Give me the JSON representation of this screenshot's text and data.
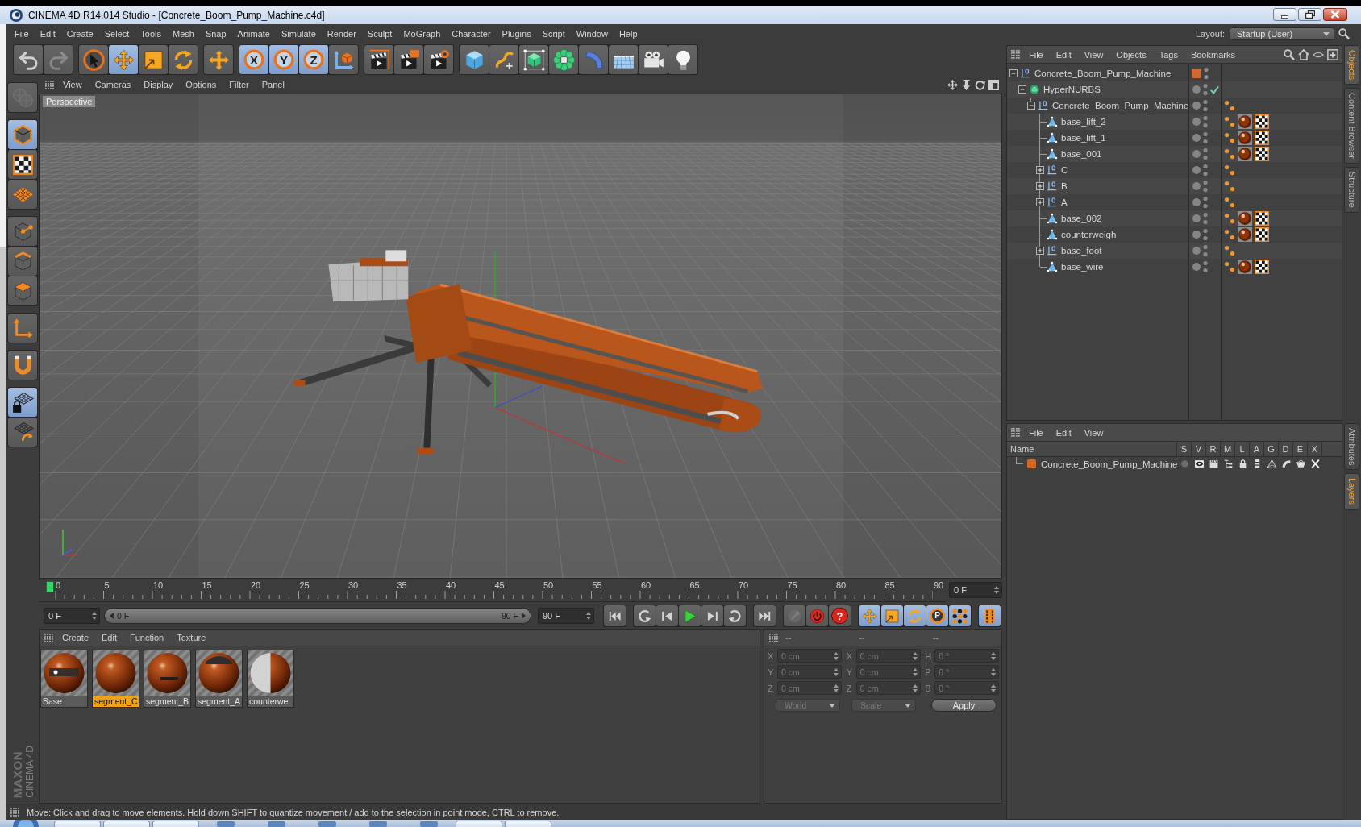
{
  "window": {
    "title": "CINEMA 4D R14.014 Studio - [Concrete_Boom_Pump_Machine.c4d]"
  },
  "menu_bar": [
    "File",
    "Edit",
    "Create",
    "Select",
    "Tools",
    "Mesh",
    "Snap",
    "Animate",
    "Simulate",
    "Render",
    "Sculpt",
    "MoGraph",
    "Character",
    "Plugins",
    "Script",
    "Window",
    "Help"
  ],
  "layout": {
    "label": "Layout:",
    "value": "Startup (User)"
  },
  "toolbar": [
    [
      {
        "kind": "undo",
        "selected": false,
        "disabled": false
      },
      {
        "kind": "redo",
        "selected": false,
        "disabled": true
      }
    ],
    [
      {
        "kind": "select",
        "selected": false,
        "disabled": false
      },
      {
        "kind": "move",
        "selected": true,
        "disabled": false
      },
      {
        "kind": "scale",
        "selected": false,
        "disabled": false
      },
      {
        "kind": "rotate",
        "selected": false,
        "disabled": false
      }
    ],
    [
      {
        "kind": "add",
        "selected": false,
        "disabled": false
      }
    ],
    [
      {
        "kind": "axis",
        "label": "X",
        "selected": true,
        "disabled": false
      },
      {
        "kind": "axis",
        "label": "Y",
        "selected": true,
        "disabled": false
      },
      {
        "kind": "axis",
        "label": "Z",
        "selected": true,
        "disabled": false
      },
      {
        "kind": "coords",
        "selected": false,
        "disabled": false
      }
    ],
    [
      {
        "kind": "render-view",
        "selected": false,
        "disabled": false
      },
      {
        "kind": "render-picture",
        "selected": false,
        "disabled": false
      },
      {
        "kind": "render-settings",
        "selected": false,
        "disabled": false
      }
    ],
    [
      {
        "kind": "cube",
        "selected": false,
        "disabled": false
      },
      {
        "kind": "spline",
        "selected": false,
        "disabled": false
      },
      {
        "kind": "subdivision",
        "selected": false,
        "disabled": false
      },
      {
        "kind": "cloner",
        "selected": false,
        "disabled": false
      },
      {
        "kind": "deformer",
        "selected": false,
        "disabled": false
      },
      {
        "kind": "floor",
        "selected": false,
        "disabled": false
      },
      {
        "kind": "camera",
        "selected": false,
        "disabled": false
      },
      {
        "kind": "light",
        "selected": false,
        "disabled": false
      }
    ]
  ],
  "tools": [
    [
      {
        "kind": "make-editable",
        "selected": false,
        "disabled": true
      }
    ],
    [
      {
        "kind": "model",
        "selected": true,
        "disabled": false
      },
      {
        "kind": "texture",
        "selected": false,
        "disabled": false
      },
      {
        "kind": "workplane",
        "selected": false,
        "disabled": false
      }
    ],
    [
      {
        "kind": "points",
        "selected": false,
        "disabled": false
      },
      {
        "kind": "edges",
        "selected": false,
        "disabled": false
      },
      {
        "kind": "polygons",
        "selected": false,
        "disabled": false
      }
    ],
    [
      {
        "kind": "axis-mode",
        "selected": false,
        "disabled": false
      }
    ],
    [
      {
        "kind": "magnet",
        "selected": false,
        "disabled": false
      }
    ],
    [
      {
        "kind": "grid-lock",
        "selected": true,
        "disabled": false
      },
      {
        "kind": "grid-rotate",
        "selected": false,
        "disabled": false
      }
    ]
  ],
  "logo": {
    "brand": "MAXON",
    "product": "CINEMA 4D"
  },
  "viewport": {
    "menu": [
      "View",
      "Cameras",
      "Display",
      "Options",
      "Filter",
      "Panel"
    ],
    "camera": "Perspective"
  },
  "timeline": {
    "ticks": [
      "0",
      "5",
      "10",
      "15",
      "20",
      "25",
      "30",
      "35",
      "40",
      "45",
      "50",
      "55",
      "60",
      "65",
      "70",
      "75",
      "80",
      "85",
      "90"
    ],
    "playhead": {
      "level": 0
    },
    "current_frame": "0 F"
  },
  "playback": {
    "start_frame": "0 F",
    "range": {
      "start": "0 F",
      "end": "90 F",
      "level": 1
    },
    "end_frame": "90 F",
    "groups": [
      [
        {
          "kind": "first-frame",
          "selected": false,
          "disabled": false
        }
      ],
      [
        {
          "kind": "prev-key",
          "selected": false,
          "disabled": false
        },
        {
          "kind": "prev-frame",
          "selected": false,
          "disabled": false
        },
        {
          "kind": "play",
          "selected": false,
          "disabled": false
        },
        {
          "kind": "next-frame",
          "selected": false,
          "disabled": false
        },
        {
          "kind": "next-key",
          "selected": false,
          "disabled": false
        }
      ],
      [
        {
          "kind": "last-frame",
          "selected": false,
          "disabled": false
        }
      ],
      [
        {
          "kind": "autokey",
          "selected": false,
          "disabled": true
        },
        {
          "kind": "record",
          "selected": false,
          "disabled": false
        },
        {
          "kind": "key-selection",
          "label": "?",
          "selected": false,
          "disabled": false
        }
      ],
      [
        {
          "kind": "key-move",
          "selected": true,
          "disabled": false
        },
        {
          "kind": "key-scale",
          "selected": true,
          "disabled": false
        },
        {
          "kind": "key-rotate",
          "selected": true,
          "disabled": false
        },
        {
          "kind": "key-param",
          "label": "P",
          "selected": true,
          "disabled": false
        },
        {
          "kind": "key-pla",
          "selected": true,
          "disabled": false
        }
      ],
      [
        {
          "kind": "timeline",
          "selected": true,
          "disabled": false
        }
      ]
    ]
  },
  "materials": {
    "menu": [
      "Create",
      "Edit",
      "Function",
      "Texture"
    ],
    "items": [
      {
        "name": "Base",
        "selected": false
      },
      {
        "name": "segment_C",
        "selected": true
      },
      {
        "name": "segment_B",
        "selected": false
      },
      {
        "name": "segment_A",
        "selected": false
      },
      {
        "name": "counterwe",
        "selected": false
      }
    ]
  },
  "coordinates": {
    "headers": [
      "--",
      "--",
      "--"
    ],
    "disabled": true,
    "rows": [
      [
        {
          "axis": "X",
          "value": "0 cm"
        },
        {
          "axis": "X",
          "value": "0 cm"
        },
        {
          "axis": "H",
          "value": "0 °"
        }
      ],
      [
        {
          "axis": "Y",
          "value": "0 cm"
        },
        {
          "axis": "Y",
          "value": "0 cm"
        },
        {
          "axis": "P",
          "value": "0 °"
        }
      ],
      [
        {
          "axis": "Z",
          "value": "0 cm"
        },
        {
          "axis": "Z",
          "value": "0 cm"
        },
        {
          "axis": "B",
          "value": "0 °"
        }
      ]
    ],
    "dropdowns": [
      "World",
      "Scale"
    ],
    "apply": "Apply"
  },
  "status_bar": "Move: Click and drag to move elements. Hold down SHIFT to quantize movement / add to the selection in point mode, CTRL to remove.",
  "object_manager": {
    "menu": [
      "File",
      "Edit",
      "View",
      "Objects",
      "Tags",
      "Bookmarks"
    ],
    "tree": [
      {
        "name": "Concrete_Boom_Pump_Machine",
        "kind": "null",
        "expanded": true,
        "color": "#d2692c",
        "children": [
          {
            "name": "HyperNURBS",
            "kind": "subdivision",
            "expanded": true,
            "enabled": true,
            "children": [
              {
                "name": "Concrete_Boom_Pump_Machine",
                "kind": "null",
                "expanded": true,
                "tags": [
                  {
                    "kind": "phong"
                  }
                ],
                "children": [
                  {
                    "name": "base_lift_2",
                    "kind": "polygon",
                    "tags": [
                      {
                        "kind": "phong"
                      },
                      {
                        "kind": "material"
                      },
                      {
                        "kind": "uvw"
                      }
                    ]
                  },
                  {
                    "name": "base_lift_1",
                    "kind": "polygon",
                    "tags": [
                      {
                        "kind": "phong"
                      },
                      {
                        "kind": "material"
                      },
                      {
                        "kind": "uvw"
                      }
                    ]
                  },
                  {
                    "name": "base_001",
                    "kind": "polygon",
                    "tags": [
                      {
                        "kind": "phong"
                      },
                      {
                        "kind": "material"
                      },
                      {
                        "kind": "uvw"
                      }
                    ]
                  },
                  {
                    "name": "C",
                    "kind": "null",
                    "expanded": false,
                    "tags": [
                      {
                        "kind": "phong"
                      }
                    ]
                  },
                  {
                    "name": "B",
                    "kind": "null",
                    "expanded": false,
                    "tags": [
                      {
                        "kind": "phong"
                      }
                    ]
                  },
                  {
                    "name": "A",
                    "kind": "null",
                    "expanded": false,
                    "tags": [
                      {
                        "kind": "phong"
                      }
                    ]
                  },
                  {
                    "name": "base_002",
                    "kind": "polygon",
                    "tags": [
                      {
                        "kind": "phong"
                      },
                      {
                        "kind": "material"
                      },
                      {
                        "kind": "uvw"
                      }
                    ]
                  },
                  {
                    "name": "counterweigh",
                    "kind": "polygon",
                    "tags": [
                      {
                        "kind": "phong"
                      },
                      {
                        "kind": "material"
                      },
                      {
                        "kind": "uvw"
                      }
                    ]
                  },
                  {
                    "name": "base_foot",
                    "kind": "null",
                    "expanded": false,
                    "tags": [
                      {
                        "kind": "phong"
                      }
                    ]
                  },
                  {
                    "name": "base_wire",
                    "kind": "polygon",
                    "tags": [
                      {
                        "kind": "phong"
                      },
                      {
                        "kind": "material"
                      },
                      {
                        "kind": "uvw"
                      }
                    ]
                  }
                ]
              }
            ]
          }
        ]
      }
    ]
  },
  "layer_manager": {
    "menu": [
      "File",
      "Edit",
      "View"
    ],
    "columns": [
      "Name",
      "S",
      "V",
      "R",
      "M",
      "L",
      "A",
      "G",
      "D",
      "E",
      "X"
    ],
    "rows": [
      {
        "name": "Concrete_Boom_Pump_Machine",
        "color": "#d2692c",
        "flags": [
          {
            "kind": "solo",
            "on": false
          },
          {
            "kind": "view",
            "on": true
          },
          {
            "kind": "render",
            "on": true
          },
          {
            "kind": "manager",
            "on": true
          },
          {
            "kind": "lock",
            "on": true
          },
          {
            "kind": "animation",
            "on": true
          },
          {
            "kind": "generators",
            "on": true
          },
          {
            "kind": "deformers",
            "on": true
          },
          {
            "kind": "expressions",
            "on": true
          },
          {
            "kind": "xref",
            "on": true
          }
        ]
      }
    ]
  },
  "side_tabs": [
    [
      {
        "label": "Objects",
        "selected": true
      },
      {
        "label": "Content Browser",
        "selected": false
      },
      {
        "label": "Structure",
        "selected": false
      }
    ],
    [
      {
        "label": "Attributes",
        "selected": false
      },
      {
        "label": "Layers",
        "selected": true
      }
    ]
  ],
  "taskbar": [
    {
      "kind": "start"
    },
    {
      "kind": "window"
    },
    {
      "kind": "window"
    },
    {
      "kind": "window"
    },
    {
      "kind": "pinned"
    },
    {
      "kind": "pinned"
    },
    {
      "kind": "pinned"
    },
    {
      "kind": "pinned"
    },
    {
      "kind": "pinned"
    },
    {
      "kind": "window"
    },
    {
      "kind": "window"
    }
  ]
}
